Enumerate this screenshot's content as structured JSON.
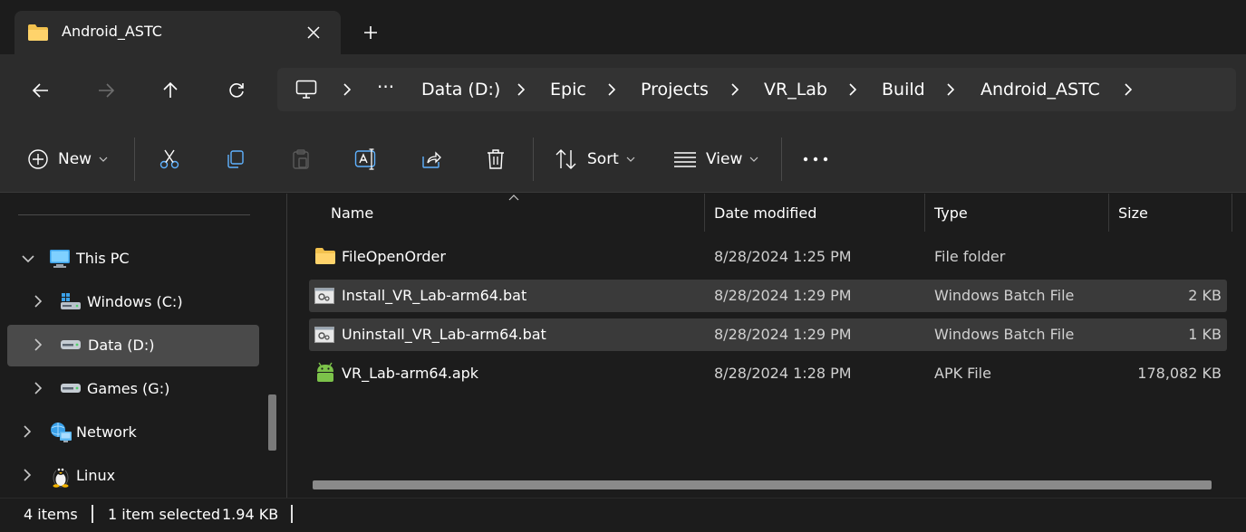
{
  "window": {
    "tab_title": "Android_ASTC",
    "new_tab_symbol": "+"
  },
  "breadcrumb": {
    "overflow": "···",
    "items": [
      "Data (D:)",
      "Epic",
      "Projects",
      "VR_Lab",
      "Build",
      "Android_ASTC"
    ]
  },
  "toolbar": {
    "new_label": "New",
    "sort_label": "Sort",
    "view_label": "View"
  },
  "sidebar": {
    "items": [
      {
        "label": "This PC",
        "icon": "computer-icon",
        "expanded": true
      },
      {
        "label": "Windows (C:)",
        "icon": "windows-drive-icon"
      },
      {
        "label": "Data (D:)",
        "icon": "drive-icon",
        "selected": true
      },
      {
        "label": "Games (G:)",
        "icon": "drive-icon"
      },
      {
        "label": "Network",
        "icon": "network-icon"
      },
      {
        "label": "Linux",
        "icon": "linux-icon"
      }
    ]
  },
  "columns": {
    "name": "Name",
    "date": "Date modified",
    "type": "Type",
    "size": "Size"
  },
  "files": [
    {
      "name": "FileOpenOrder",
      "date": "8/28/2024 1:25 PM",
      "type": "File folder",
      "size": "",
      "icon": "folder-icon",
      "highlight": false
    },
    {
      "name": "Install_VR_Lab-arm64.bat",
      "date": "8/28/2024 1:29 PM",
      "type": "Windows Batch File",
      "size": "2 KB",
      "icon": "batch-file-icon",
      "highlight": true
    },
    {
      "name": "Uninstall_VR_Lab-arm64.bat",
      "date": "8/28/2024 1:29 PM",
      "type": "Windows Batch File",
      "size": "1 KB",
      "icon": "batch-file-icon",
      "highlight": true
    },
    {
      "name": "VR_Lab-arm64.apk",
      "date": "8/28/2024 1:28 PM",
      "type": "APK File",
      "size": "178,082 KB",
      "icon": "android-icon",
      "highlight": false
    }
  ],
  "status": {
    "item_count": "4 items",
    "selection": "1 item selected",
    "selection_size": "1.94 KB"
  },
  "colors": {
    "background": "#1c1c1c",
    "chrome": "#2c2c2c",
    "folder": "#f2c14e",
    "android": "#7cc24a",
    "selection": "#4a4a4a"
  }
}
